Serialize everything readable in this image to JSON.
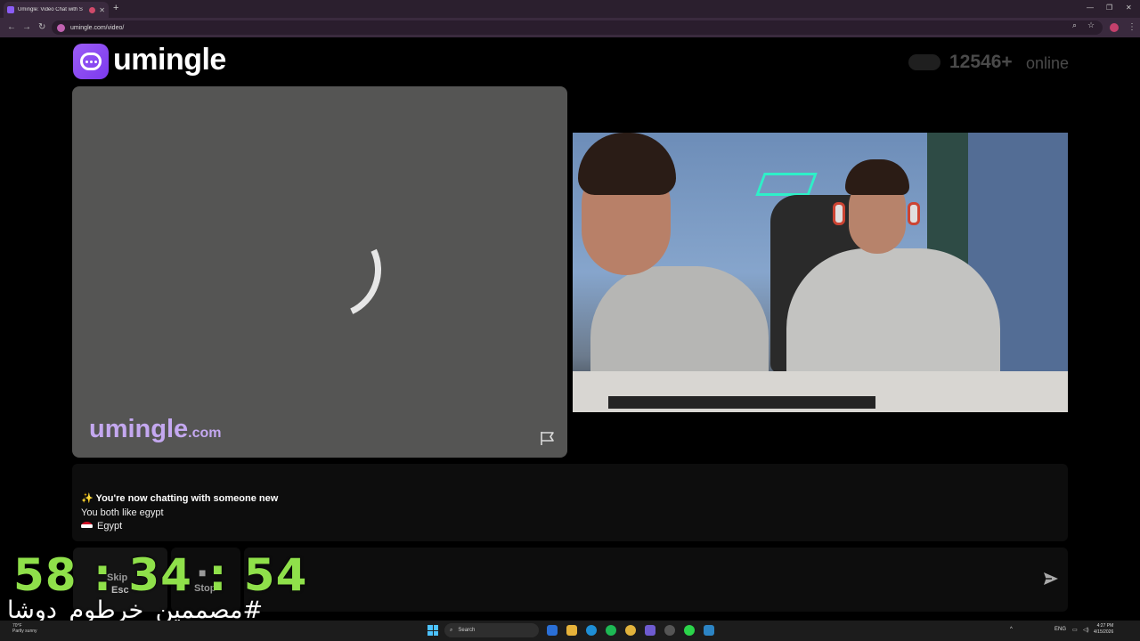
{
  "browser": {
    "tab_title": "Umingle: Video Chat with S",
    "url": "umingle.com/video/"
  },
  "header": {
    "logo_text": "umingle",
    "online_count": "12546+",
    "online_label": "online"
  },
  "video_left": {
    "watermark_main": "umingle",
    "watermark_suffix": ".com"
  },
  "chat": {
    "messages": [
      {
        "icon": "sparkles-icon",
        "text": "✨ You're now chatting with someone new"
      },
      {
        "text": "You both like egypt"
      },
      {
        "icon": "egypt-flag-icon",
        "text": "Egypt"
      }
    ]
  },
  "controls": {
    "skip_label": "Skip",
    "skip_shortcut": "Esc",
    "stop_label": "Stop",
    "message_placeholder": ""
  },
  "overlay": {
    "timer": "58 : 34 : 54",
    "caption": "#مصممين_خرطوم_دوشا"
  },
  "taskbar": {
    "weather_temp": "70°F",
    "weather_desc": "Partly sunny",
    "search_label": "Search",
    "language": "ENG",
    "time": "4:27 PM",
    "date": "4/15/2026"
  },
  "colors": {
    "brand": "#8b5cf6",
    "timer": "#8fe04a"
  }
}
